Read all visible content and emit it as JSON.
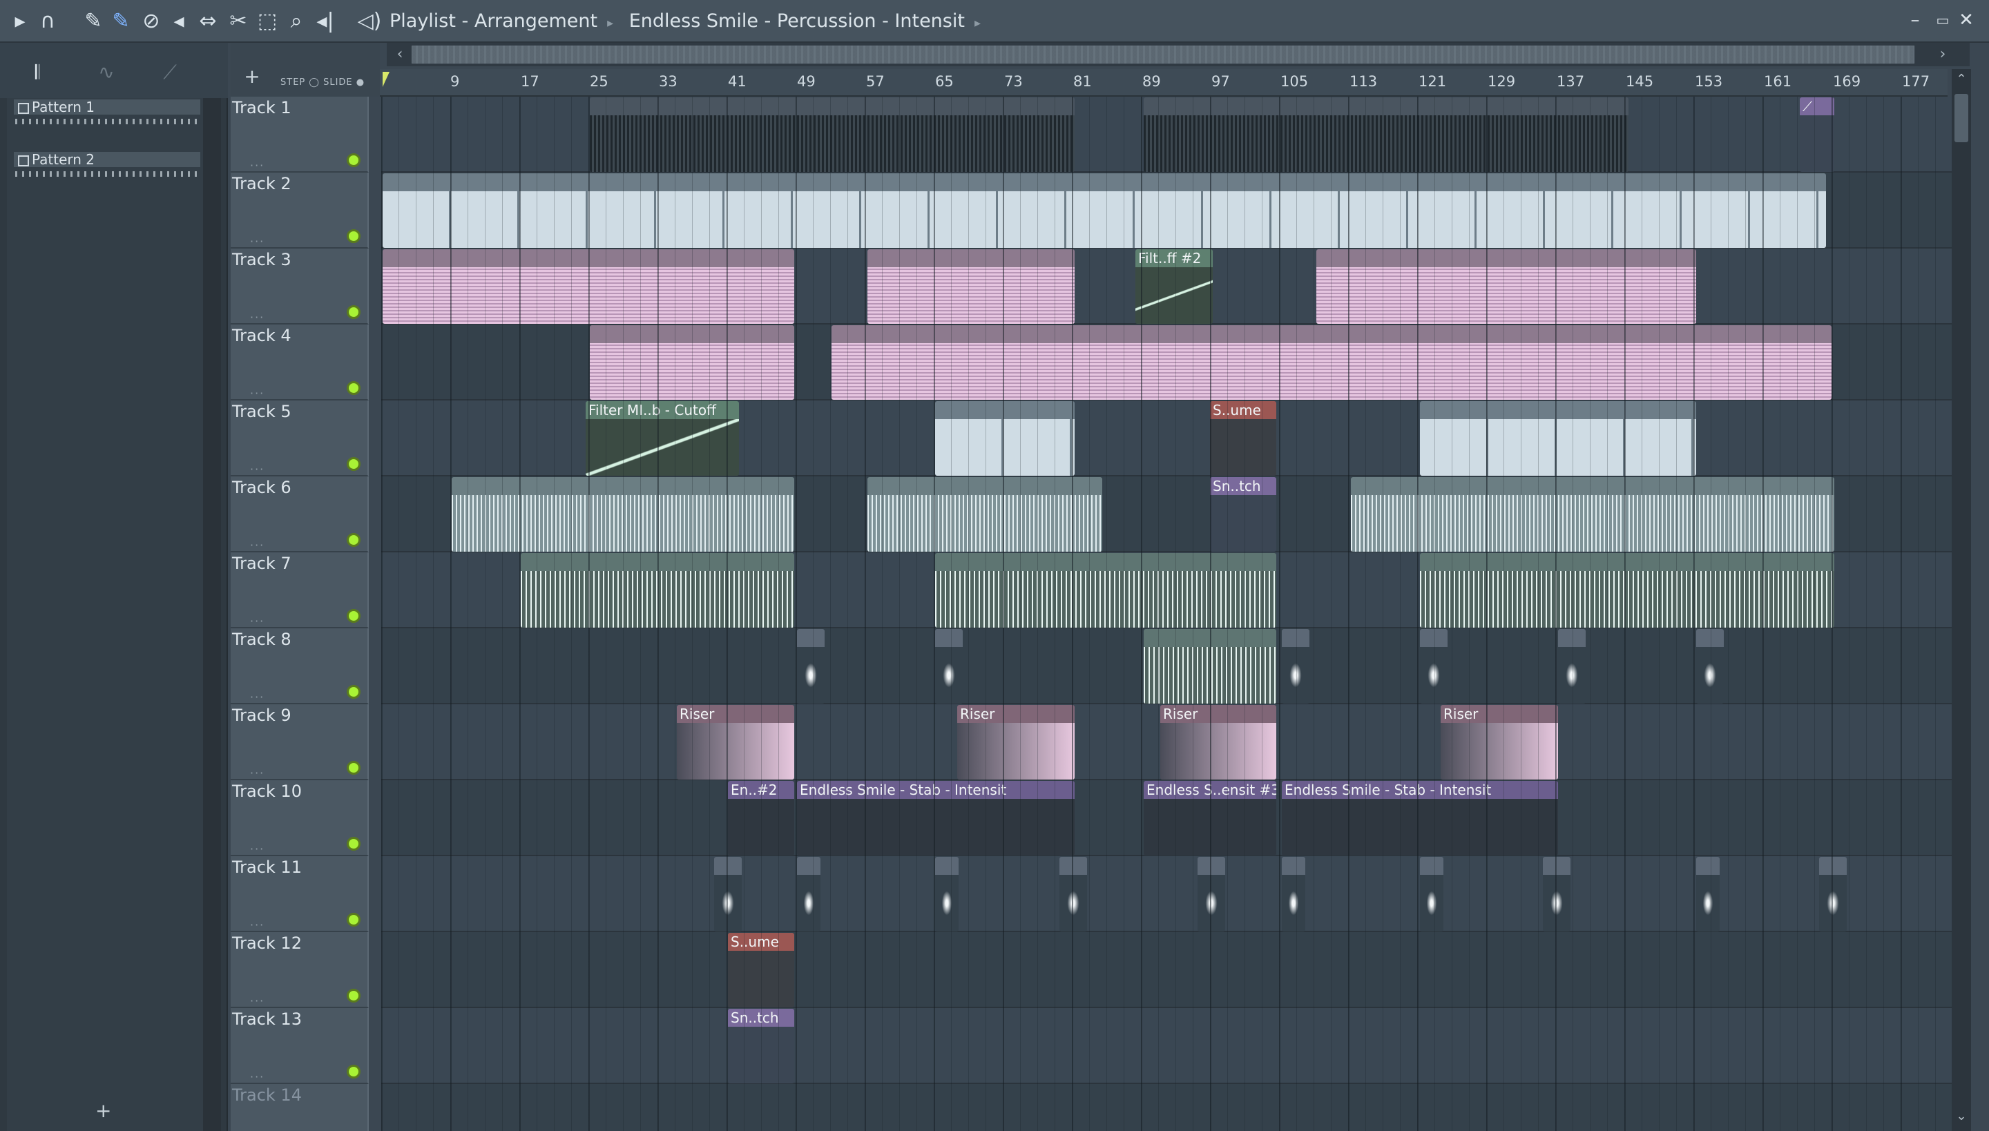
{
  "window": {
    "title_parts": [
      "Playlist - Arrangement",
      "Endless Smile - Percussion - Intensit"
    ],
    "controls": [
      "minimize",
      "maximize",
      "close"
    ]
  },
  "toolbar": {
    "icons": [
      "play-arrow-icon",
      "magnet-icon",
      "pencil-icon",
      "paint-icon",
      "delete-icon",
      "mute-icon",
      "slip-icon",
      "slice-icon",
      "select-icon",
      "zoom-icon",
      "playback-icon",
      "speaker-icon"
    ]
  },
  "left_panel": {
    "patterns": [
      {
        "label": "Pattern 1"
      },
      {
        "label": "Pattern 2"
      }
    ],
    "add_label": "+"
  },
  "controls": {
    "add_track": "+",
    "step_label": "STEP",
    "slide_label": "SLIDE"
  },
  "ruler": {
    "bars": [
      "9",
      "17",
      "25",
      "33",
      "41",
      "49",
      "57",
      "65",
      "73",
      "81",
      "89",
      "97",
      "105",
      "113",
      "121",
      "129",
      "137",
      "145",
      "153",
      "161",
      "169",
      "177"
    ]
  },
  "tracks": [
    {
      "name": "Track 1"
    },
    {
      "name": "Track 2"
    },
    {
      "name": "Track 3"
    },
    {
      "name": "Track 4"
    },
    {
      "name": "Track 5"
    },
    {
      "name": "Track 6"
    },
    {
      "name": "Track 7"
    },
    {
      "name": "Track 8"
    },
    {
      "name": "Track 9"
    },
    {
      "name": "Track 10"
    },
    {
      "name": "Track 11"
    },
    {
      "name": "Track 12"
    },
    {
      "name": "Track 13"
    },
    {
      "name": "Track 14"
    }
  ],
  "clip_labels": {
    "filt_ff2": "Filt..ff #2",
    "filter_cutoff": "Filter MI..b - Cutoff",
    "s_ume": "S..ume",
    "sn_tch": "Sn..tch",
    "riser": "Riser",
    "en_2": "En..#2",
    "stab_intensit": "Endless Smile - Stab - Intensit",
    "stab_intensit3": "Endless S..ensit #3"
  },
  "colors": {
    "led_on": "#a9f235",
    "accent_pink": "#e6c5e0",
    "accent_blue": "#cfdce4"
  }
}
